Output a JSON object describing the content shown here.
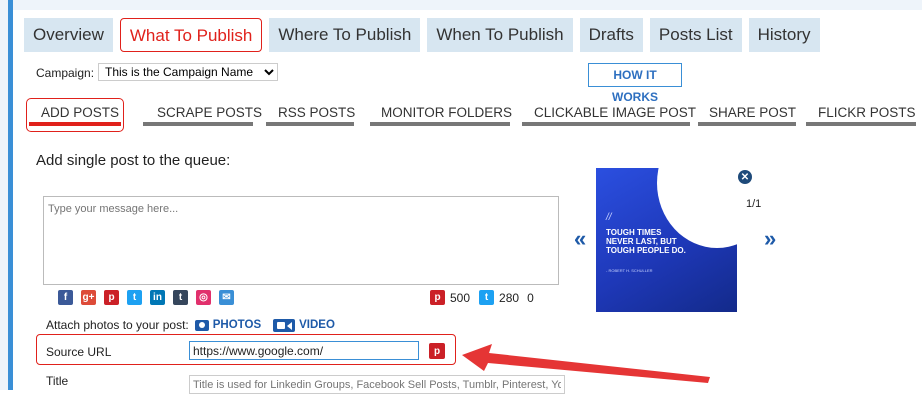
{
  "tabs": [
    {
      "label": "Overview",
      "active": false
    },
    {
      "label": "What To Publish",
      "active": true
    },
    {
      "label": "Where To Publish",
      "active": false
    },
    {
      "label": "When To Publish",
      "active": false
    },
    {
      "label": "Drafts",
      "active": false
    },
    {
      "label": "Posts List",
      "active": false
    },
    {
      "label": "History",
      "active": false
    }
  ],
  "campaign": {
    "label": "Campaign:",
    "selected": "This is the Campaign Name"
  },
  "how_it_works": "HOW IT WORKS",
  "subtabs": [
    "ADD POSTS",
    "SCRAPE POSTS",
    "RSS POSTS",
    "MONITOR FOLDERS",
    "CLICKABLE IMAGE POST",
    "SHARE POST",
    "FLICKR POSTS"
  ],
  "heading": "Add single post to the queue:",
  "message": {
    "placeholder": "Type your message here..."
  },
  "social_icons": [
    "facebook-icon",
    "google-plus-icon",
    "pinterest-icon",
    "twitter-icon",
    "linkedin-icon",
    "tumblr-icon",
    "instagram-icon",
    "email-icon"
  ],
  "counts": {
    "pinterest": "500",
    "twitter": "280",
    "other": "0"
  },
  "attach": {
    "label": "Attach photos to your post:",
    "photos": "PHOTOS",
    "video": "VIDEO"
  },
  "source_url": {
    "label": "Source URL",
    "value": "https://www.google.com/"
  },
  "title_field": {
    "label": "Title",
    "placeholder": "Title is used for Linkedin Groups, Facebook Sell Posts, Tumblr, Pinterest, Yo"
  },
  "preview": {
    "quote_lines": [
      "TOUGH TIMES",
      "NEVER LAST, BUT",
      "TOUGH PEOPLE DO."
    ],
    "author": "- ROBERT H. SCHULLER",
    "counter": "1/1",
    "prev": "«",
    "next": "»"
  },
  "colors": {
    "accent": "#e0211b",
    "brand": "#3a8fd6",
    "tab_bg": "#d7e6f1",
    "link": "#1e5aa8"
  }
}
